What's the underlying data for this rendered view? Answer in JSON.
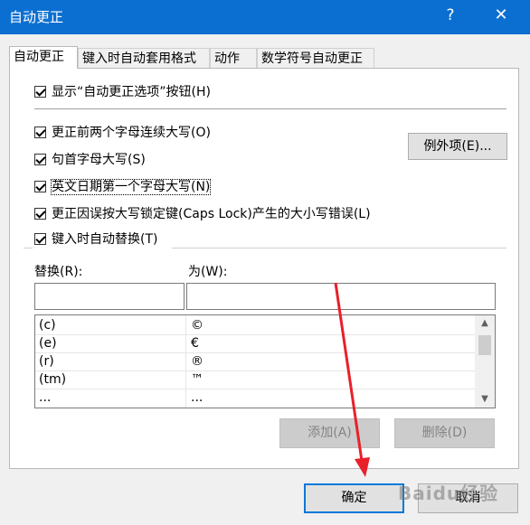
{
  "window": {
    "title": "自动更正",
    "help": "?",
    "close": "✕"
  },
  "tabs": [
    {
      "label": "自动更正",
      "active": true
    },
    {
      "label": "键入时自动套用格式"
    },
    {
      "label": "动作"
    },
    {
      "label": "数学符号自动更正"
    }
  ],
  "options": {
    "show_buttons": "显示“自动更正选项”按钮(H)",
    "two_initial_caps": "更正前两个字母连续大写(O)",
    "capitalize_sentences": "句首字母大写(S)",
    "capitalize_days": "英文日期第一个字母大写(N)",
    "caps_lock": "更正因误按大写锁定键(Caps Lock)产生的大小写错误(L)",
    "replace_as_you_type": "键入时自动替换(T)"
  },
  "buttons": {
    "exceptions": "例外项(E)...",
    "add": "添加(A)",
    "delete": "删除(D)",
    "ok": "确定",
    "cancel": "取消"
  },
  "fields": {
    "replace_label": "替换(R):",
    "with_label": "为(W):"
  },
  "list": {
    "rows": [
      {
        "replace": "(c)",
        "with": "©"
      },
      {
        "replace": "(e)",
        "with": "€"
      },
      {
        "replace": "(r)",
        "with": "®"
      },
      {
        "replace": "(tm)",
        "with": "™"
      },
      {
        "replace": "...",
        "with": "..."
      }
    ]
  },
  "watermark": "Baidu经验",
  "colors": {
    "titlebar": "#0b6fd1",
    "default_border": "#0078d7",
    "annotation_arrow": "#e8202a"
  }
}
